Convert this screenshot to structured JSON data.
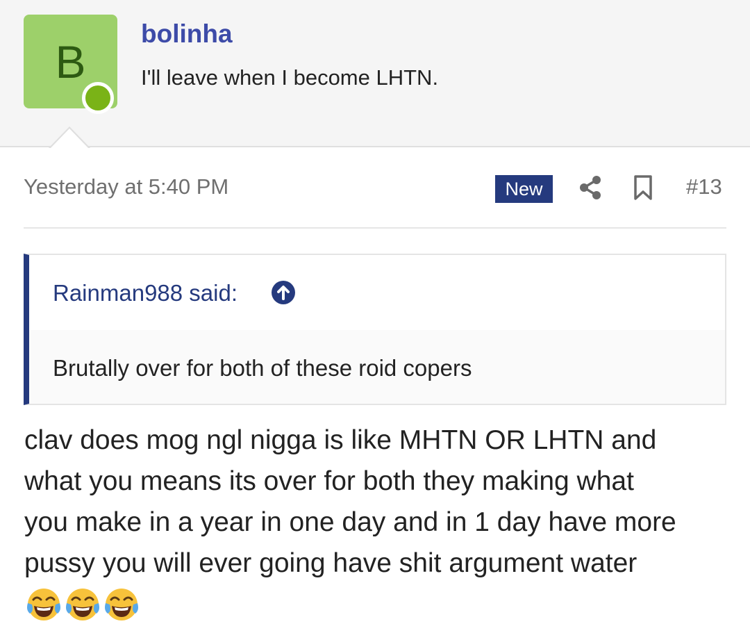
{
  "user": {
    "avatar_letter": "B",
    "name": "bolinha",
    "title": "I'll leave when I become LHTN.",
    "avatar_color": "#9dd06a",
    "online_color": "#7ab317"
  },
  "post": {
    "timestamp": "Yesterday at 5:40 PM",
    "badge": "New",
    "number": "#13",
    "icons": [
      "share-icon",
      "bookmark-icon"
    ]
  },
  "quote": {
    "author_said": "Rainman988 said:",
    "icon": "arrow-up-circle-icon",
    "text": "Brutally over for both of these roid copers"
  },
  "message": {
    "lines": [
      "clav does mog ngl nigga is like MHTN OR LHTN and",
      "what you means its over for both they making what",
      "you make in a year in one day and in 1 day have more",
      "pussy you will ever going have shit argument water"
    ],
    "emojis": [
      "face-with-tears-of-joy-icon",
      "face-with-tears-of-joy-icon",
      "face-with-tears-of-joy-icon"
    ]
  },
  "colors": {
    "accent": "#253a7e",
    "username": "#3d4ba8",
    "header_bg": "#f5f5f5"
  }
}
